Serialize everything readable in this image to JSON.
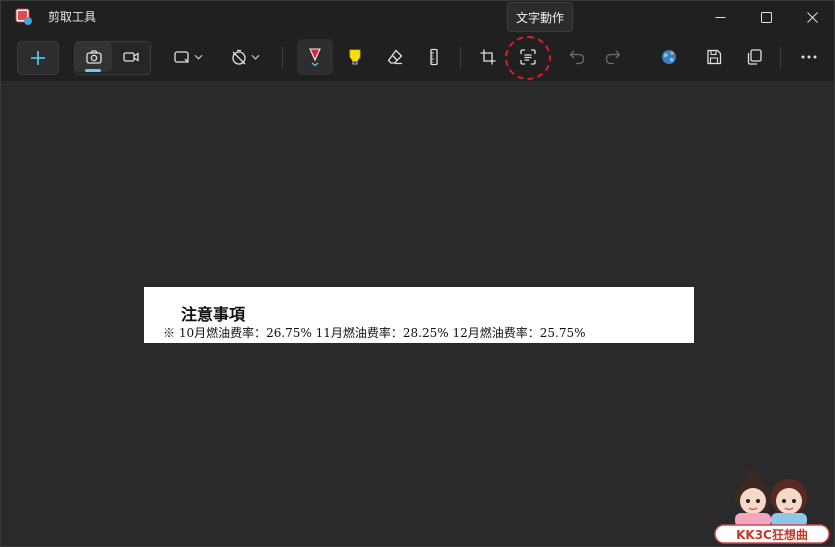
{
  "window": {
    "title": "剪取工具",
    "controls": [
      "minimize",
      "maximize",
      "close"
    ]
  },
  "tooltip": {
    "text": "文字動作"
  },
  "toolbar": {
    "items": [
      {
        "name": "new",
        "icon": "plus-icon"
      },
      {
        "name": "screenshot-mode",
        "icon": "camera-icon",
        "active": true
      },
      {
        "name": "video-mode",
        "icon": "video-camera-icon"
      },
      {
        "name": "snip-shape",
        "icon": "rectangle-snip-icon"
      },
      {
        "name": "delay",
        "icon": "no-delay-timer-icon"
      },
      {
        "name": "ballpoint-pen",
        "icon": "pen-icon",
        "color": "#e0203a",
        "active": true
      },
      {
        "name": "highlighter",
        "icon": "highlighter-icon",
        "color": "#f5e100"
      },
      {
        "name": "eraser",
        "icon": "eraser-icon"
      },
      {
        "name": "ruler",
        "icon": "ruler-icon"
      },
      {
        "name": "crop",
        "icon": "crop-icon"
      },
      {
        "name": "text-actions",
        "icon": "text-actions-icon",
        "highlighted": true
      },
      {
        "name": "undo",
        "icon": "undo-icon",
        "enabled": false
      },
      {
        "name": "redo",
        "icon": "redo-icon",
        "enabled": false
      },
      {
        "name": "edit-in-paint",
        "icon": "paint-globe-icon"
      },
      {
        "name": "save",
        "icon": "save-icon"
      },
      {
        "name": "copy",
        "icon": "copy-icon"
      },
      {
        "name": "more",
        "icon": "more-icon"
      }
    ]
  },
  "snip": {
    "title": "注意事項",
    "line": "※   10月燃油费率：26.75% 11月燃油费率：28.25% 12月燃油费率：25.75%"
  },
  "watermark": {
    "text": "KK3C狂想曲"
  },
  "colors": {
    "accent": "#60cdff",
    "annotation": "#d32020",
    "background": "#272729"
  }
}
